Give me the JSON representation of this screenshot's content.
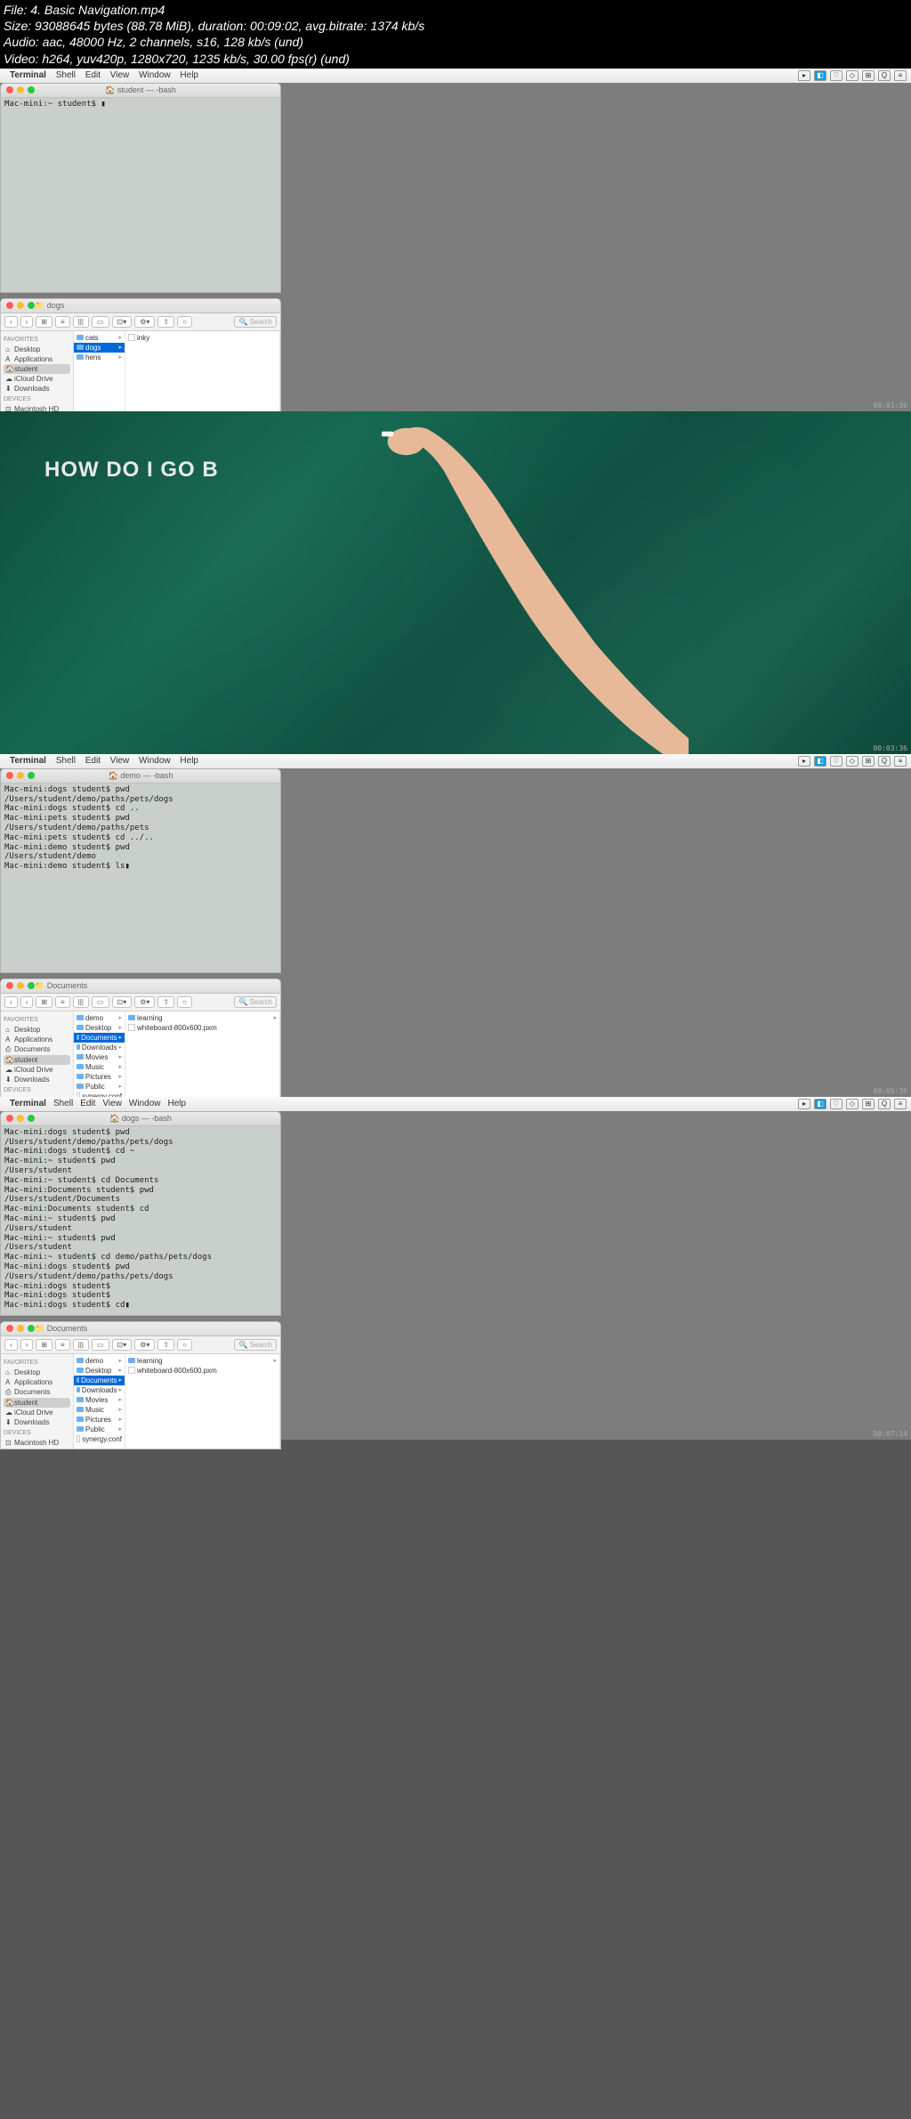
{
  "fileinfo": {
    "line1": "File: 4. Basic Navigation.mp4",
    "line2": "Size: 93088645 bytes (88.78 MiB), duration: 00:09:02, avg.bitrate: 1374 kb/s",
    "line3": "Audio: aac, 48000 Hz, 2 channels, s16, 128 kb/s (und)",
    "line4": "Video: h264, yuv420p, 1280x720, 1235 kb/s, 30.00 fps(r) (und)"
  },
  "menubar": {
    "apple": "",
    "items": [
      "Terminal",
      "Shell",
      "Edit",
      "View",
      "Window",
      "Help"
    ]
  },
  "frame1": {
    "term_title": "🏠 student — -bash",
    "term_content": "Mac-mini:~ student$ ▮",
    "finder_title": "📁 dogs",
    "finder_search": "🔍 Search",
    "sidebar_favorites": "Favorites",
    "sidebar_devices": "Devices",
    "sidebar_items": [
      {
        "icon": "⌂",
        "label": "Desktop"
      },
      {
        "icon": "A",
        "label": "Applications"
      },
      {
        "icon": "🏠",
        "label": "student",
        "sel": true
      },
      {
        "icon": "☁",
        "label": "iCloud Drive"
      },
      {
        "icon": "⬇",
        "label": "Downloads"
      }
    ],
    "sidebar_devices_items": [
      {
        "icon": "⊡",
        "label": "Macintosh HD"
      }
    ],
    "col1": [
      {
        "t": "cats",
        "arr": true
      },
      {
        "t": "dogs",
        "arr": true,
        "sel": true
      },
      {
        "t": "hens",
        "arr": true
      }
    ],
    "col2": [
      {
        "t": "inky",
        "file": true
      }
    ],
    "timestamp": "00:01:50"
  },
  "chalkboard": {
    "text": "HOW DO I GO B",
    "timestamp": "00:03:36"
  },
  "frame3": {
    "term_title": "🏠 demo — -bash",
    "term_content": "Mac-mini:dogs student$ pwd\n/Users/student/demo/paths/pets/dogs\nMac-mini:dogs student$ cd ..\nMac-mini:pets student$ pwd\n/Users/student/demo/paths/pets\nMac-mini:pets student$ cd ../..\nMac-mini:demo student$ pwd\n/Users/student/demo\nMac-mini:demo student$ ls▮",
    "finder_title": "📁 Documents",
    "col1": [
      {
        "t": "demo",
        "arr": true
      },
      {
        "t": "Desktop",
        "arr": true
      },
      {
        "t": "Documents",
        "arr": true,
        "sel": true
      },
      {
        "t": "Downloads",
        "arr": true
      },
      {
        "t": "Movies",
        "arr": true
      },
      {
        "t": "Music",
        "arr": true
      },
      {
        "t": "Pictures",
        "arr": true
      },
      {
        "t": "Public",
        "arr": true
      },
      {
        "t": "synergy.conf",
        "file": true
      }
    ],
    "col2": [
      {
        "t": "learning",
        "arr": true
      },
      {
        "t": "whiteboard-800x600.pxm",
        "file": true
      }
    ],
    "timestamp": "00:05:36"
  },
  "frame4": {
    "term_title": "🏠 dogs — -bash",
    "term_content": "Mac-mini:dogs student$ pwd\n/Users/student/demo/paths/pets/dogs\nMac-mini:dogs student$ cd ~\nMac-mini:~ student$ pwd\n/Users/student\nMac-mini:~ student$ cd Documents\nMac-mini:Documents student$ pwd\n/Users/student/Documents\nMac-mini:Documents student$ cd\nMac-mini:~ student$ pwd\n/Users/student\nMac-mini:~ student$ pwd\n/Users/student\nMac-mini:~ student$ cd demo/paths/pets/dogs\nMac-mini:dogs student$ pwd\n/Users/student/demo/paths/pets/dogs\nMac-mini:dogs student$\nMac-mini:dogs student$\nMac-mini:dogs student$ cd▮",
    "finder_title": "📁 Documents",
    "timestamp": "00:07:14"
  }
}
